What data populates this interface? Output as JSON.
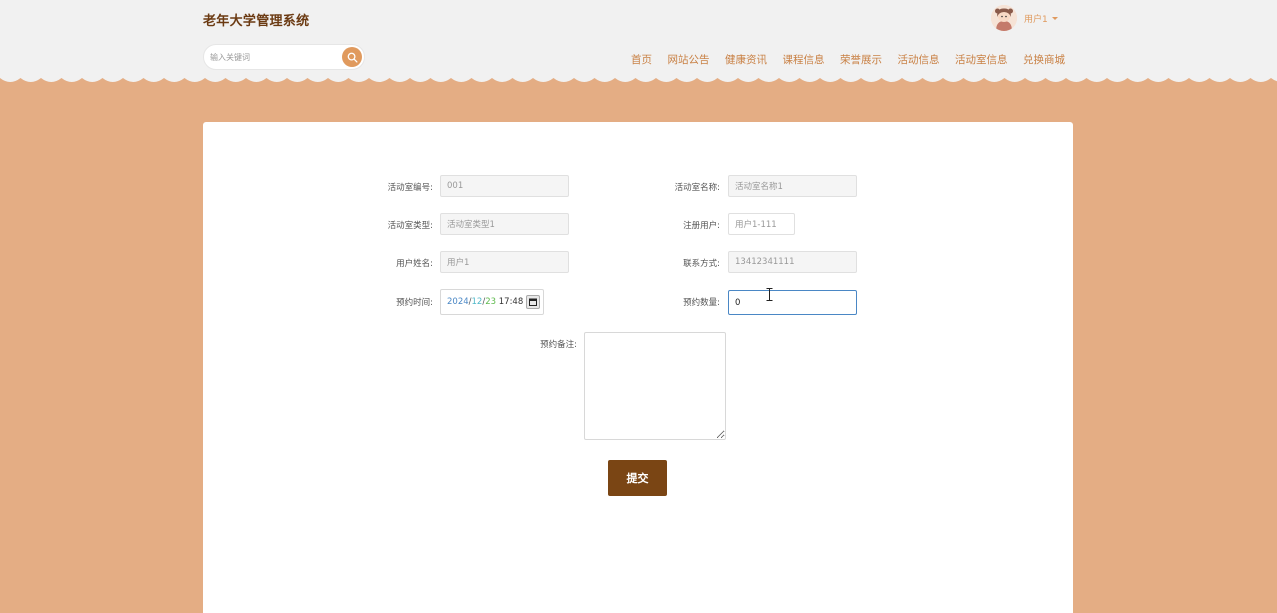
{
  "header": {
    "site_title": "老年大学管理系统",
    "search_placeholder": "输入关键词",
    "user_name": "用户1"
  },
  "nav": {
    "items": [
      "首页",
      "网站公告",
      "健康资讯",
      "课程信息",
      "荣誉展示",
      "活动信息",
      "活动室信息",
      "兑换商城"
    ]
  },
  "form": {
    "room_no_label": "活动室编号:",
    "room_no_value": "001",
    "room_name_label": "活动室名称:",
    "room_name_value": "活动室名称1",
    "room_type_label": "活动室类型:",
    "room_type_value": "活动室类型1",
    "reg_user_label": "注册用户:",
    "reg_user_value": "用户1-111",
    "user_name_label": "用户姓名:",
    "user_name_value": "用户1",
    "contact_label": "联系方式:",
    "contact_value": "13412341111",
    "time_label": "预约时间:",
    "time_year": "2024",
    "time_month": "12",
    "time_day": "23",
    "time_clock": "17:48",
    "qty_label": "预约数量:",
    "qty_value": "0",
    "note_label": "预约备注:",
    "submit_label": "提交"
  },
  "colors": {
    "page_bg": "#e4ad84",
    "header_bg": "#f1f1f1",
    "brand": "#6b3a12",
    "nav_text": "#c98145",
    "accent": "#e09a5e",
    "submit_bg": "#7a4514"
  },
  "icons": {
    "search": "search-icon",
    "calendar": "calendar-icon",
    "dropdown": "chevron-down-icon",
    "avatar": "avatar"
  }
}
